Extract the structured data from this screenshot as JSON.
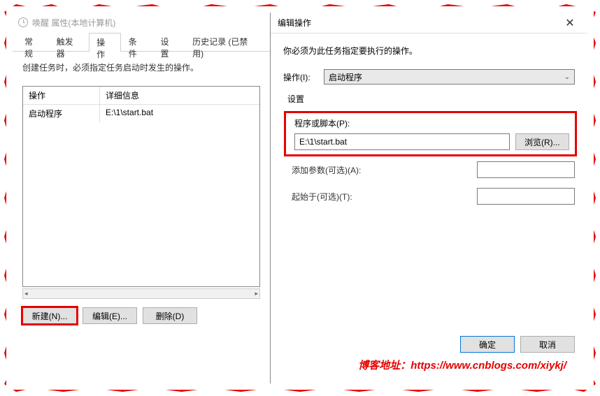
{
  "parent": {
    "title": "唤醒 属性(本地计算机)",
    "tabs": [
      "常规",
      "触发器",
      "操作",
      "条件",
      "设置",
      "历史记录 (已禁用)"
    ],
    "active_tab_idx": 2,
    "instruction": "创建任务时，必须指定任务启动时发生的操作。",
    "table": {
      "headers": [
        "操作",
        "详细信息"
      ],
      "rows": [
        {
          "action": "启动程序",
          "detail": "E:\\1\\start.bat"
        }
      ]
    },
    "buttons": {
      "new": "新建(N)...",
      "edit": "编辑(E)...",
      "delete": "删除(D)"
    }
  },
  "dialog": {
    "title": "编辑操作",
    "instruction": "你必须为此任务指定要执行的操作。",
    "action_label": "操作(I):",
    "action_value": "启动程序",
    "settings_label": "设置",
    "script_label": "程序或脚本(P):",
    "script_value": "E:\\1\\start.bat",
    "browse": "浏览(R)...",
    "args_label": "添加参数(可选)(A):",
    "args_value": "",
    "startin_label": "起始于(可选)(T):",
    "startin_value": "",
    "ok": "确定",
    "cancel": "取消"
  },
  "watermark": {
    "label": "博客地址：",
    "url": "https://www.cnblogs.com/xiykj/"
  },
  "icons": {
    "close": "✕",
    "chevron": "⌄",
    "left": "◂",
    "right": "▸"
  }
}
